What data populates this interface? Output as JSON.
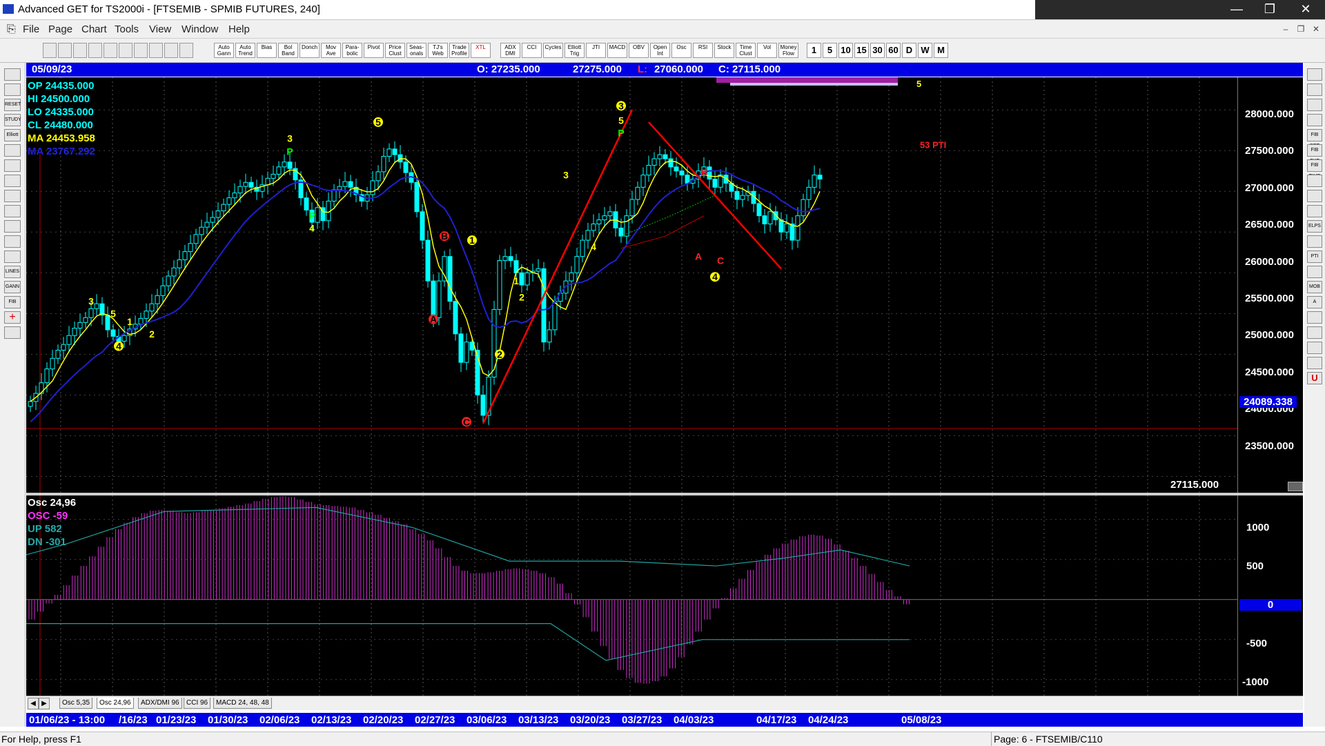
{
  "window": {
    "title": "Advanced GET for TS2000i - [FTSEMIB - SPMIB FUTURES, 240]"
  },
  "menu": {
    "items": [
      "File",
      "Page",
      "Chart",
      "Tools",
      "View",
      "Window",
      "Help"
    ]
  },
  "toolbar": {
    "groups": [
      [
        "Auto Gann",
        "Auto Trend",
        "Bias",
        "Bol Band",
        "Donch",
        "Mov Ave",
        "Para- bolic",
        "Pivot",
        "Price Clust",
        "Seas- onals",
        "TJ's Web",
        "Trade Profile",
        "XTL"
      ],
      [
        "ADX DMI",
        "CCI",
        "Cycles",
        "Elliott Trig",
        "JTI",
        "MACD",
        "OBV",
        "Open Int",
        "Osc",
        "RSI",
        "Stock",
        "Time Clust",
        "Vol",
        "Money Flow"
      ]
    ],
    "intervals": [
      "1",
      "5",
      "10",
      "15",
      "30",
      "60",
      "D",
      "W",
      "M"
    ]
  },
  "left_tools": [
    "RESET",
    "STUDY",
    "Elliott",
    "LINES",
    "GANN",
    "FIB"
  ],
  "right_tools": [
    "FIB RET",
    "FIB EXT",
    "FIB TIME",
    "ELPS",
    "PTI",
    "MOB",
    "A",
    "U"
  ],
  "header": {
    "date": "05/09/23",
    "open": "O: 27235.000",
    "high": "27275.000",
    "low_label": "L:",
    "low": "27060.000",
    "close": "C: 27115.000"
  },
  "info": {
    "op": "OP  24435.000",
    "hi": "HI   24500.000",
    "lo": "LO  24335.000",
    "cl": "CL  24480.000",
    "ma1": "MA  24453.958",
    "ma2": "MA  23767.292"
  },
  "osc_info": {
    "title": "Osc 24,96",
    "osc": "OSC -59",
    "up": "UP   582",
    "dn": "DN   -301"
  },
  "price_axis": {
    "labels": [
      "28000.000",
      "27500.000",
      "27000.000",
      "26500.000",
      "26000.000",
      "25500.000",
      "25000.000",
      "24500.000",
      "24000.000",
      "23500.000"
    ],
    "marker": "24089.338",
    "last": "27115.000"
  },
  "osc_axis": {
    "labels": [
      "1000",
      "500",
      "0",
      "-500",
      "-1000"
    ]
  },
  "chart_data": [
    {
      "type": "candlestick",
      "ylim": [
        23300,
        28400
      ],
      "colors": {
        "bars": "#00ffff",
        "ma_fast": "#ffff00",
        "ma_slow": "#2020d0",
        "elliott": "#ff0000"
      },
      "closes": [
        24420,
        24520,
        24650,
        24820,
        24950,
        25050,
        25120,
        25230,
        25320,
        25390,
        25450,
        25560,
        25620,
        25480,
        25300,
        25220,
        25160,
        25230,
        25310,
        25370,
        25440,
        25530,
        25620,
        25720,
        25840,
        25960,
        26060,
        26160,
        26260,
        26360,
        26470,
        26560,
        26620,
        26680,
        26760,
        26840,
        26920,
        26980,
        27060,
        27110,
        27050,
        27000,
        27080,
        27160,
        27210,
        27300,
        27360,
        27280,
        27140,
        26920,
        26770,
        26620,
        26800,
        26640,
        26880,
        27020,
        27060,
        27120,
        27050,
        26960,
        26880,
        26960,
        27130,
        27240,
        27430,
        27520,
        27450,
        27360,
        27230,
        27110,
        26750,
        26400,
        25900,
        25450,
        25900,
        26200,
        25650,
        25250,
        24900,
        25150,
        25050,
        24500,
        24250,
        24720,
        25550,
        26150,
        26200,
        26150,
        26000,
        25850,
        26000,
        26020,
        26050,
        25150,
        25300,
        25650,
        25750,
        25900,
        26000,
        26200,
        26400,
        26520,
        26600,
        26650,
        26700,
        26750,
        26550,
        26450,
        26700,
        26900,
        27050,
        27200,
        27320,
        27400,
        27450,
        27400,
        27300,
        27250,
        27200,
        27100,
        27150,
        27250,
        27300,
        27150,
        27050,
        27200,
        27100,
        27000,
        26900,
        26950,
        27000,
        26850,
        26700,
        26600,
        26750,
        26650,
        26500,
        26600,
        26400,
        26700,
        26900,
        27050,
        27200,
        27150
      ]
    },
    {
      "type": "bar",
      "ylim": [
        -1200,
        1300
      ],
      "values": [
        -250,
        -150,
        -50,
        60,
        180,
        300,
        420,
        540,
        660,
        780,
        880,
        960,
        1030,
        1080,
        1110,
        1120,
        1110,
        1090,
        1080,
        1090,
        1110,
        1120,
        1140,
        1160,
        1180,
        1200,
        1230,
        1260,
        1280,
        1290,
        1280,
        1250,
        1220,
        1190,
        1180,
        1170,
        1160,
        1150,
        1120,
        1090,
        1060,
        1020,
        980,
        940,
        880,
        820,
        740,
        640,
        530,
        420,
        360,
        330,
        330,
        340,
        360,
        380,
        390,
        380,
        360,
        330,
        280,
        200,
        80,
        -60,
        -220,
        -400,
        -580,
        -740,
        -880,
        -980,
        -1040,
        -1050,
        -1020,
        -960,
        -860,
        -720,
        -560,
        -400,
        -250,
        -110,
        20,
        140,
        260,
        370,
        470,
        560,
        640,
        700,
        750,
        790,
        810,
        800,
        760,
        690,
        610,
        520,
        420,
        320,
        220,
        120,
        40,
        -59
      ]
    }
  ],
  "tabs": [
    "Osc 5,35",
    "Osc 24,96",
    "ADX/DMI 96",
    "CCI 96",
    "MACD 24, 48, 48"
  ],
  "date_axis": {
    "labels": [
      "01/06/23 - 13:00",
      "/16/23",
      "01/23/23",
      "01/30/23",
      "02/06/23",
      "02/13/23",
      "02/20/23",
      "02/27/23",
      "03/06/23",
      "03/13/23",
      "03/20/23",
      "03/27/23",
      "04/03/23",
      "04/17/23",
      "04/24/23",
      "05/08/23"
    ]
  },
  "elliott_labels": {
    "yellow": [
      "3",
      "5",
      "4",
      "1",
      "2",
      "3",
      "4",
      "5",
      "1",
      "2",
      "1",
      "2",
      "3",
      "4",
      "3",
      "5",
      "4"
    ],
    "green": [
      "P",
      "P",
      "P"
    ],
    "red": [
      "A",
      "B",
      "C",
      "A",
      "B",
      "C"
    ],
    "pti": "53 PTI",
    "wave5": "5"
  },
  "status": {
    "help": "For Help, press F1",
    "page": "Page: 6 - FTSEMIB/C110"
  }
}
